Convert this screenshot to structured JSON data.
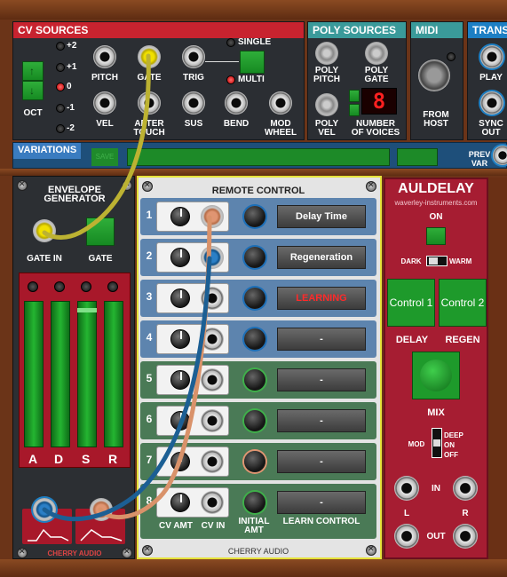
{
  "cv_sources": {
    "title": "CV SOURCES",
    "octave_values": [
      "+2",
      "+1",
      "0",
      "-1",
      "-2"
    ],
    "octave_label": "OCT",
    "jacks": [
      "PITCH",
      "GATE",
      "TRIG",
      "VEL",
      "AFTER\nTOUCH",
      "SUS",
      "BEND",
      "MOD\nWHEEL"
    ],
    "mode_single": "SINGLE",
    "mode_multi": "MULTI"
  },
  "poly_sources": {
    "title": "POLY SOURCES",
    "poly_pitch": "POLY\nPITCH",
    "poly_gate": "POLY\nGATE",
    "poly_vel": "POLY\nVEL",
    "voices_label": "NUMBER\nOF VOICES",
    "voices_value": "8"
  },
  "midi": {
    "title": "MIDI",
    "from_host": "FROM\nHOST"
  },
  "trans": {
    "title": "TRANS",
    "play": "PLAY",
    "sync_out": "SYNC\nOUT"
  },
  "variations": {
    "title": "VARIATIONS",
    "save": "SAVE",
    "prev_var": "PREV\nVAR"
  },
  "envelope": {
    "title": "ENVELOPE\nGENERATOR",
    "gate_in": "GATE IN",
    "gate": "GATE",
    "sliders": [
      "A",
      "D",
      "S",
      "R"
    ],
    "footer": "CHERRY AUDIO"
  },
  "remote": {
    "title": "REMOTE CONTROL",
    "rows": [
      {
        "num": "1",
        "display": "Delay Time",
        "learning": false
      },
      {
        "num": "2",
        "display": "Regeneration",
        "learning": false
      },
      {
        "num": "3",
        "display": "LEARNING",
        "learning": true
      },
      {
        "num": "4",
        "display": "-",
        "learning": false
      },
      {
        "num": "5",
        "display": "-",
        "learning": false
      },
      {
        "num": "6",
        "display": "-",
        "learning": false
      },
      {
        "num": "7",
        "display": "-",
        "learning": false
      },
      {
        "num": "8",
        "display": "-",
        "learning": false
      }
    ],
    "cv_amt": "CV AMT",
    "cv_in": "CV IN",
    "initial_amt": "INITIAL\nAMT",
    "learn_control": "LEARN CONTROL",
    "footer": "CHERRY AUDIO"
  },
  "auldelay": {
    "title": "AULDELAY",
    "url": "waverley-instruments.com",
    "on": "ON",
    "dark": "DARK",
    "warm": "WARM",
    "control1": "Control 1",
    "control2": "Control 2",
    "delay": "DELAY",
    "regen": "REGEN",
    "mix": "MIX",
    "mod": "MOD",
    "mod_options": [
      "DEEP",
      "ON",
      "OFF"
    ],
    "in": "IN",
    "out": "OUT",
    "l": "L",
    "r": "R"
  },
  "colors": {
    "red_header": "#c8232f",
    "teal_header": "#3a9a9a",
    "blue_header": "#1d7fc4",
    "rc_blue": "#5d84ae",
    "rc_green": "#4a7a56"
  }
}
